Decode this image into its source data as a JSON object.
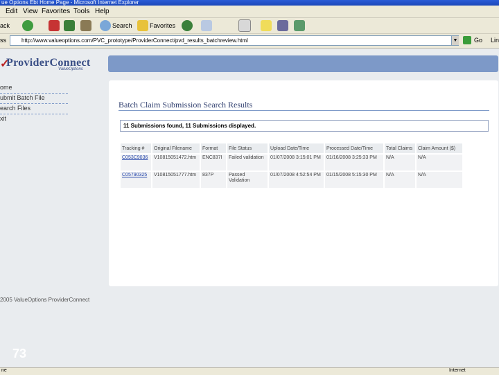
{
  "window": {
    "title": "ue Options Ebt Home Page - Microsoft Internet Explorer"
  },
  "menu": [
    "Edit",
    "View",
    "Favorites",
    "Tools",
    "Help"
  ],
  "toolbar": {
    "back_label": "ack",
    "search_label": "Search",
    "favorites_label": "Favorites"
  },
  "address": {
    "label": "ss",
    "url": "http://www.valueoptions.com/PVC_prototype/ProviderConnect/pvd_results_batchreview.html",
    "go_label": "Go",
    "links_label": "Lin"
  },
  "logo": {
    "name": "ProviderConnect",
    "sub": "ValueOptions"
  },
  "nav": {
    "items": [
      "ome",
      "ubmit Batch File",
      "earch Files",
      "xit"
    ]
  },
  "footer": {
    "copyright": "2005 ValueOptions ProviderConnect"
  },
  "page": {
    "title": "Batch Claim Submission Search Results",
    "summary": "11 Submissions found, 11 Submissions displayed."
  },
  "table": {
    "headers": [
      "Tracking #",
      "Original Filename",
      "Format",
      "File Status",
      "Upload Date/Time",
      "Processed Date/Time",
      "Total Claims",
      "Claim Amount ($)"
    ],
    "rows": [
      [
        "C053C9036",
        "V10815051472.htm",
        "ENC837I",
        "Failed validation",
        "01/07/2008 3:15:01 PM",
        "01/16/2008 3:25:33 PM",
        "N/A",
        "N/A"
      ],
      [
        "C05790325",
        "V10815051777.htm",
        "837P",
        "Passed Validation",
        "01/07/2008 4:52:54 PM",
        "01/15/2008 5:15:30 PM",
        "N/A",
        "N/A"
      ]
    ]
  },
  "slide": {
    "number": "73"
  },
  "status": {
    "left": "ne",
    "right": "Internet"
  },
  "colors": {
    "accent": "#7d99c8",
    "title": "#2f3e6e",
    "link": "#2244aa"
  }
}
